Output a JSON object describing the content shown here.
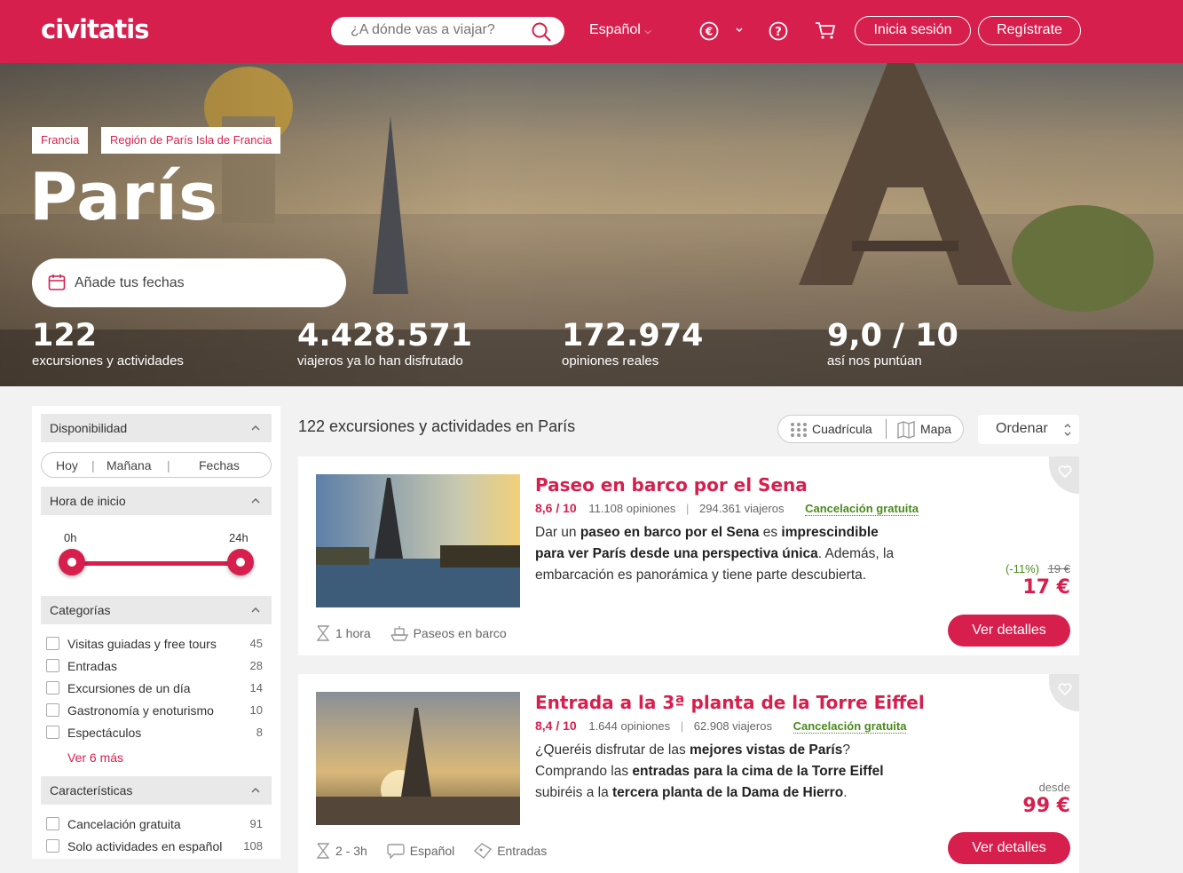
{
  "header": {
    "logo": "civitatis",
    "search_placeholder": "¿A dónde vas a viajar?",
    "language": "Español",
    "login": "Inicia sesión",
    "register": "Regístrate"
  },
  "hero": {
    "breadcrumbs": [
      "Francia",
      "Región de París Isla de Francia"
    ],
    "city": "París",
    "date_placeholder": "Añade tus fechas",
    "stats": [
      {
        "number": "122",
        "label": "excursiones y actividades"
      },
      {
        "number": "4.428.571",
        "label": "viajeros ya lo han disfrutado"
      },
      {
        "number": "172.974",
        "label": "opiniones reales"
      },
      {
        "number": "9,0 / 10",
        "label": "así nos puntúan"
      }
    ]
  },
  "filters": {
    "availability": {
      "title": "Disponibilidad",
      "options": [
        "Hoy",
        "Mañana",
        "Fechas"
      ]
    },
    "start_time": {
      "title": "Hora de inicio",
      "min_label": "0h",
      "max_label": "24h"
    },
    "categories": {
      "title": "Categorías",
      "items": [
        {
          "label": "Visitas guiadas y free tours",
          "count": "45"
        },
        {
          "label": "Entradas",
          "count": "28"
        },
        {
          "label": "Excursiones de un día",
          "count": "14"
        },
        {
          "label": "Gastronomía y enoturismo",
          "count": "10"
        },
        {
          "label": "Espectáculos",
          "count": "8"
        }
      ],
      "more": "Ver 6 más"
    },
    "features": {
      "title": "Características",
      "items": [
        {
          "label": "Cancelación gratuita",
          "count": "91"
        },
        {
          "label": "Solo actividades en español",
          "count": "108"
        }
      ]
    }
  },
  "results": {
    "title": "122 excursiones y actividades en París",
    "view_grid": "Cuadrícula",
    "view_map": "Mapa",
    "sort": "Ordenar",
    "cards": [
      {
        "title": "Paseo en barco por el Sena",
        "rating": "8,6 / 10",
        "opinions": "11.108 opiniones",
        "travelers": "294.361 viajeros",
        "cancel": "Cancelación gratuita",
        "desc": [
          "Dar un ",
          "paseo en barco por el Sena",
          " es ",
          "imprescindible para ver París desde una perspectiva única",
          ". Además, la embarcación es panorámica y tiene parte descubierta."
        ],
        "features": [
          "1 hora",
          "Paseos en barco"
        ],
        "discount": "(-11%)",
        "old_price": "19 €",
        "price": "17 €",
        "button": "Ver detalles"
      },
      {
        "title": "Entrada a la 3ª planta de la Torre Eiffel",
        "rating": "8,4 / 10",
        "opinions": "1.644 opiniones",
        "travelers": "62.908 viajeros",
        "cancel": "Cancelación gratuita",
        "desc": [
          "¿Queréis disfrutar de las ",
          "mejores vistas de París",
          "? Comprando las ",
          "entradas para la cima de la Torre Eiffel",
          " subiréis a la ",
          "tercera planta de la Dama de Hierro",
          "."
        ],
        "features": [
          "2 - 3h",
          "Español",
          "Entradas"
        ],
        "from": "desde",
        "price": "99 €",
        "button": "Ver detalles"
      }
    ]
  }
}
